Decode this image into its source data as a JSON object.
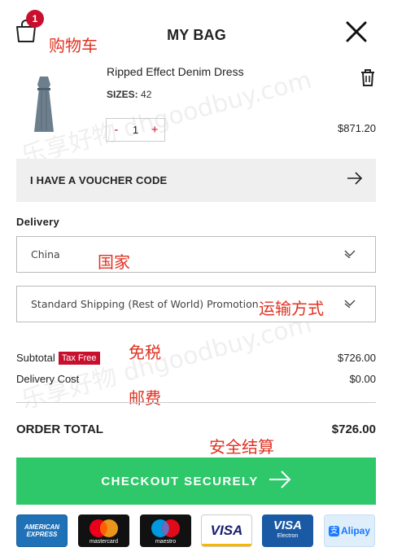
{
  "header": {
    "title": "MY BAG",
    "cart_count": "1",
    "cart_annotation": "购物车"
  },
  "watermark": {
    "text_1": "乐享好物 dhgoodbuy.com",
    "text_2": "乐享好物 dhgoodbuy.com"
  },
  "product": {
    "name": "Ripped Effect Denim Dress",
    "size_label": "SIZES:",
    "size_value": "42",
    "qty_minus": "-",
    "qty": "1",
    "qty_plus": "+",
    "price": "$871.20"
  },
  "voucher": {
    "label": "I HAVE A VOUCHER CODE"
  },
  "delivery": {
    "section_label": "Delivery",
    "country": "China",
    "country_annotation": "国家",
    "shipping": "Standard Shipping (Rest of World) Promotion",
    "shipping_annotation": "运输方式"
  },
  "totals": {
    "subtotal_label": "Subtotal",
    "tax_free_badge": "Tax Free",
    "tax_free_annotation": "免税",
    "subtotal_value": "$726.00",
    "delivery_label": "Delivery Cost",
    "delivery_annotation": "邮费",
    "delivery_value": "$0.00",
    "order_total_label": "ORDER TOTAL",
    "order_total_value": "$726.00"
  },
  "checkout": {
    "label": "CHECKOUT SECURELY",
    "annotation": "安全结算"
  },
  "payment_methods": {
    "amex_line1": "AMERICAN",
    "amex_line2": "EXPRESS",
    "mastercard": "mastercard",
    "maestro": "maestro",
    "visa": "VISA",
    "electron_line1": "VISA",
    "electron_line2": "Electron",
    "alipay": "Alipay"
  },
  "colors": {
    "accent_red": "#c8102e",
    "checkout_green": "#2ec86a",
    "annotation_red": "#e03222"
  }
}
